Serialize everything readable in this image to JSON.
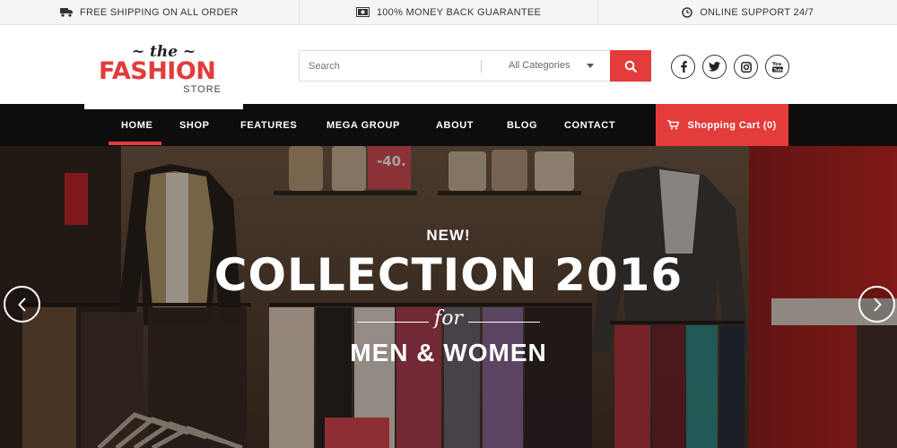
{
  "topbar": {
    "shipping": "FREE SHIPPING ON ALL ORDER",
    "money_back": "100% MONEY BACK GUARANTEE",
    "support": "ONLINE SUPPORT 24/7"
  },
  "logo": {
    "the": "~ the ~",
    "main": "FASHION",
    "store": "STORE"
  },
  "search": {
    "placeholder": "Search",
    "category": "All Categories"
  },
  "social": [
    "facebook-icon",
    "twitter-icon",
    "instagram-icon",
    "youtube-icon"
  ],
  "nav": {
    "items": [
      "HOME",
      "SHOP",
      "FEATURES",
      "MEGA GROUP",
      "ABOUT",
      "BLOG",
      "CONTACT"
    ],
    "active": "HOME",
    "cart": "Shopping Cart (0)"
  },
  "hero": {
    "new": "NEW!",
    "title": "COLLECTION 2016",
    "for": "for",
    "subtitle": "MEN & WOMEN",
    "sale_tag": "-40."
  },
  "colors": {
    "accent": "#e43b3b",
    "nav_bg": "#0d0d0d",
    "topbar_bg": "#f5f5f5"
  }
}
